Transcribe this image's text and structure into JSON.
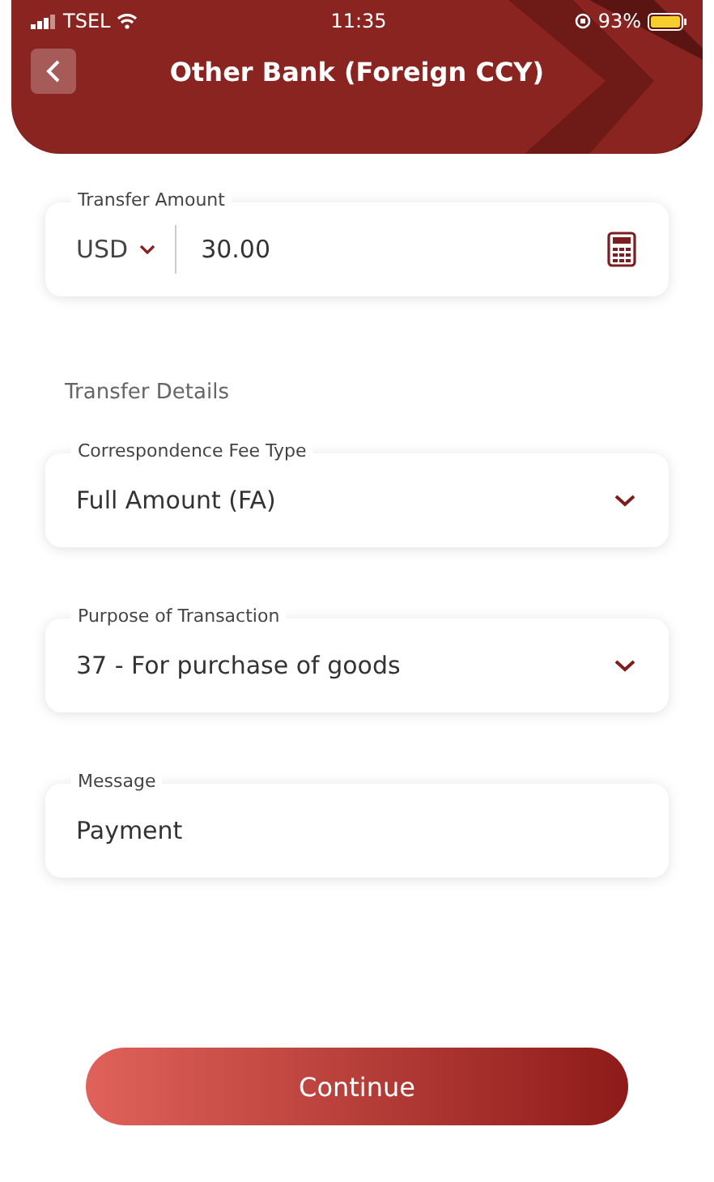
{
  "status_bar": {
    "carrier": "TSEL",
    "time": "11:35",
    "battery": "93%"
  },
  "header": {
    "title": "Other Bank (Foreign CCY)"
  },
  "amount": {
    "label": "Transfer Amount",
    "currency": "USD",
    "value": "30.00"
  },
  "section_title": "Transfer Details",
  "fields": [
    {
      "kind": "select",
      "label": "Correspondence Fee Type",
      "value": "Full Amount (FA)"
    },
    {
      "kind": "select",
      "label": "Purpose of Transaction",
      "value": "37 - For purchase of goods"
    },
    {
      "kind": "text",
      "label": "Message",
      "value": "Payment"
    }
  ],
  "buttons": [
    "Continue"
  ]
}
